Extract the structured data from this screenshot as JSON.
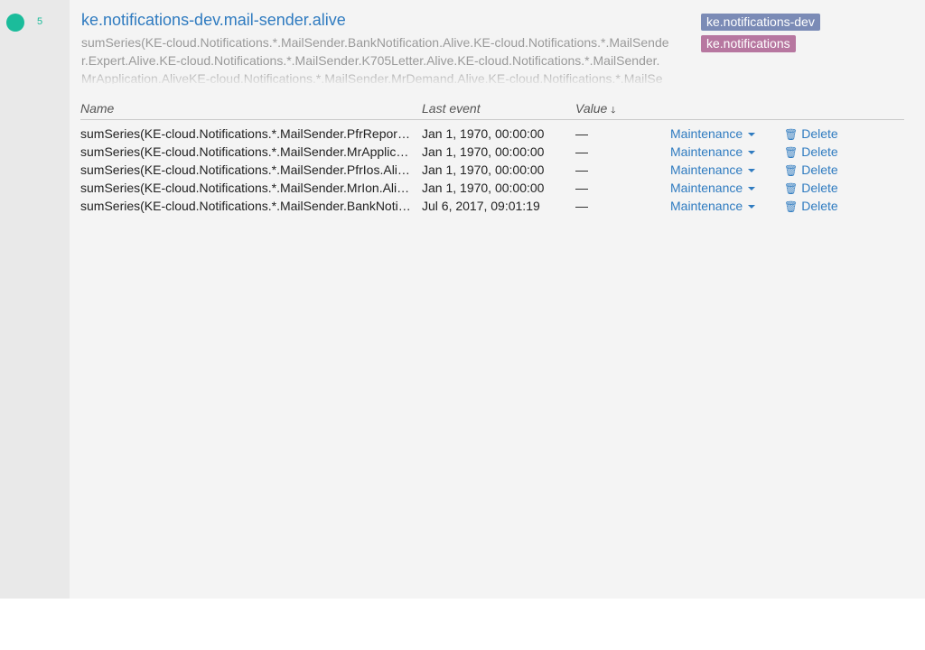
{
  "check": {
    "status_count": "5",
    "title": "ke.notifications-dev.mail-sender.alive",
    "target": "sumSeries(KE-cloud.Notifications.*.MailSender.BankNotification.Alive.KE-cloud.Notifications.*.MailSender.Expert.Alive.KE-cloud.Notifications.*.MailSender.K705Letter.Alive.KE-cloud.Notifications.*.MailSender.MrApplication.AliveKE-cloud.Notifications.*.MailSender.MrDemand.Alive.KE-cloud.Notifications.*.MailSe",
    "tags": [
      "ke.notifications-dev",
      "ke.notifications"
    ],
    "status_color": "#1bbc9b"
  },
  "table": {
    "headers": {
      "name": "Name",
      "last_event": "Last event",
      "value": "Value"
    },
    "rows": [
      {
        "name": "sumSeries(KE-cloud.Notifications.*.MailSender.PfrReport.Alive)",
        "last_event": "Jan 1, 1970, 00:00:00",
        "value": "—",
        "maintenance": "Maintenance",
        "delete": "Delete"
      },
      {
        "name": "sumSeries(KE-cloud.Notifications.*.MailSender.MrApplication.Alive)",
        "last_event": "Jan 1, 1970, 00:00:00",
        "value": "—",
        "maintenance": "Maintenance",
        "delete": "Delete"
      },
      {
        "name": "sumSeries(KE-cloud.Notifications.*.MailSender.PfrIos.Alive)",
        "last_event": "Jan 1, 1970, 00:00:00",
        "value": "—",
        "maintenance": "Maintenance",
        "delete": "Delete"
      },
      {
        "name": "sumSeries(KE-cloud.Notifications.*.MailSender.MrIon.Alive)",
        "last_event": "Jan 1, 1970, 00:00:00",
        "value": "—",
        "maintenance": "Maintenance",
        "delete": "Delete"
      },
      {
        "name": "sumSeries(KE-cloud.Notifications.*.MailSender.BankNotification.Alive)",
        "last_event": "Jul 6, 2017, 09:01:19",
        "value": "—",
        "maintenance": "Maintenance",
        "delete": "Delete"
      }
    ]
  },
  "icons": {
    "sort": "arrow-down-icon",
    "maintenance_caret": "caret-down-icon",
    "delete": "trash-icon"
  },
  "colors": {
    "link": "#2f7bc0",
    "tag_dev": "#7b8bb6",
    "tag_main": "#b777a0"
  }
}
